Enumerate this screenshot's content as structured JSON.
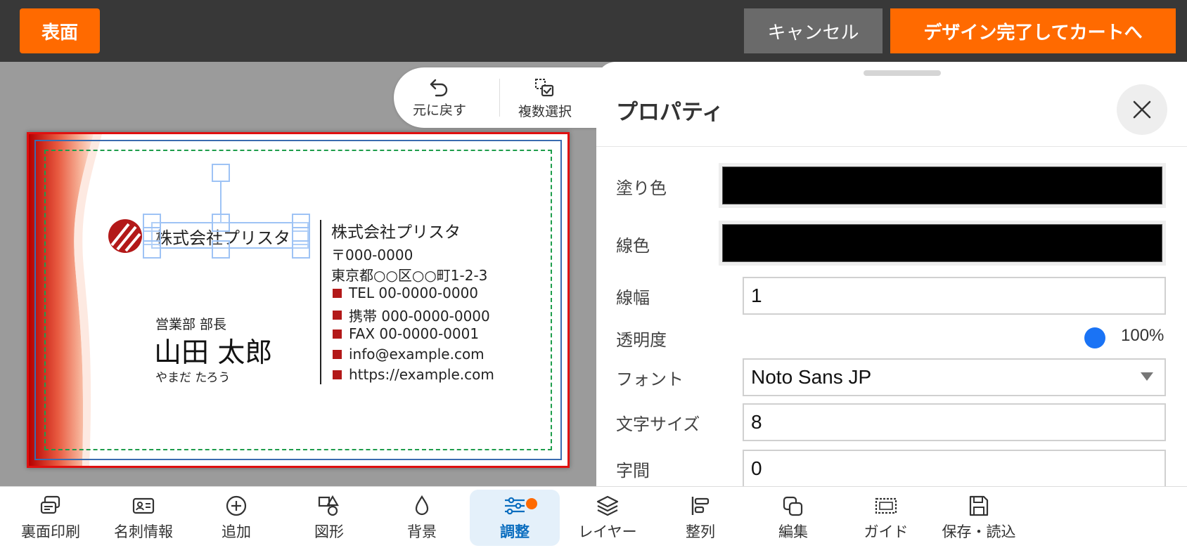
{
  "topbar": {
    "side_label": "表面",
    "cancel_label": "キャンセル",
    "finish_label": "デザイン完了してカートへ"
  },
  "float_toolbar": {
    "undo_label": "元に戻す",
    "undo_icon": "undo-icon",
    "multi_select_label": "複数選択",
    "multi_select_icon": "multi-select-icon"
  },
  "card": {
    "logo_text": "株式会社プリスタ",
    "department": "営業部 部長",
    "name": "山田 太郎",
    "kana": "やまだ たろう",
    "company": "株式会社プリスタ",
    "zip": "〒000-0000",
    "address": "東京都○○区○○町1-2-3",
    "contacts": [
      "TEL 00-0000-0000",
      "携帯 000-0000-0000",
      "FAX 00-0000-0001",
      "info@example.com",
      "https://example.com"
    ],
    "accent_color": "#b31919"
  },
  "panel": {
    "title": "プロパティ",
    "fill_label": "塗り色",
    "fill_color": "#000000",
    "stroke_label": "線色",
    "stroke_color": "#000000",
    "stroke_width_label": "線幅",
    "stroke_width_value": "1",
    "opacity_label": "透明度",
    "opacity_value": "100%",
    "font_label": "フォント",
    "font_value": "Noto Sans JP",
    "size_label": "文字サイズ",
    "size_value": "8",
    "spacing_label": "字間",
    "spacing_value": "0"
  },
  "bottombar": {
    "items": [
      {
        "label": "裏面印刷",
        "icon": "back-print-icon"
      },
      {
        "label": "名刺情報",
        "icon": "card-info-icon"
      },
      {
        "label": "追加",
        "icon": "add-icon"
      },
      {
        "label": "図形",
        "icon": "shapes-icon"
      },
      {
        "label": "背景",
        "icon": "background-icon"
      },
      {
        "label": "調整",
        "icon": "adjust-icon",
        "active": true
      },
      {
        "label": "レイヤー",
        "icon": "layers-icon"
      },
      {
        "label": "整列",
        "icon": "align-icon"
      },
      {
        "label": "編集",
        "icon": "edit-icon"
      },
      {
        "label": "ガイド",
        "icon": "guide-icon"
      },
      {
        "label": "保存・読込",
        "icon": "save-icon"
      }
    ]
  },
  "colors": {
    "brand_orange": "#ff6a00",
    "topbar_bg": "#383838",
    "active_blue": "#0a6dbf",
    "selection_blue": "#9ec3f5"
  }
}
